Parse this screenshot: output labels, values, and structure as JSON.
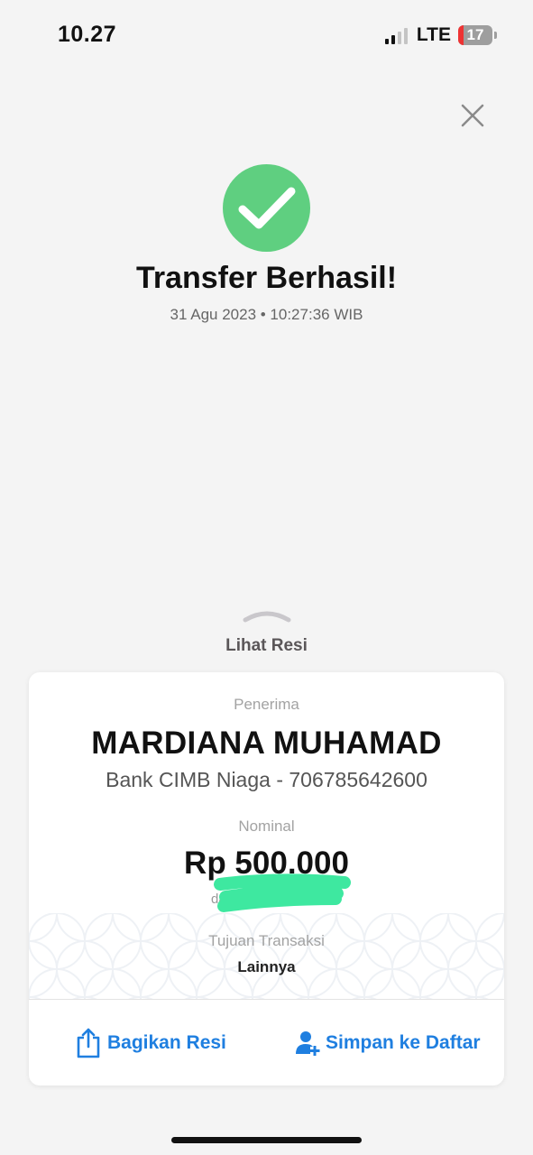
{
  "status_bar": {
    "time": "10.27",
    "network": "LTE",
    "battery": "17"
  },
  "result": {
    "title": "Transfer Berhasil!",
    "timestamp": "31 Agu 2023 • 10:27:36 WIB"
  },
  "receipt_toggle": {
    "label": "Lihat Resi"
  },
  "card": {
    "recipient_label": "Penerima",
    "recipient_name": "MARDIANA MUHAMAD",
    "bank_account": "Bank CIMB Niaga - 706785642600",
    "amount_label": "Nominal",
    "amount": "Rp 500.000",
    "from_partial": "da",
    "purpose_label": "Tujuan Transaksi",
    "purpose_value": "Lainnya"
  },
  "actions": {
    "share_label": "Bagikan Resi",
    "save_label": "Simpan ke Daftar"
  },
  "colors": {
    "success": "#5fcf80",
    "accent": "#1f7fe0",
    "redaction": "#3ee8a0"
  }
}
